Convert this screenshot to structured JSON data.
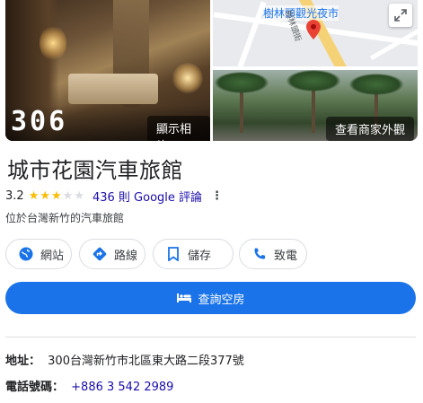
{
  "photos": {
    "main_overlay_number": "306",
    "show_photos_label": "顯示相片",
    "exterior_label": "查看商家外觀"
  },
  "map": {
    "poi_label": "樹林頭觀光夜市",
    "street_label": "樹林頭街"
  },
  "business": {
    "name": "城市花園汽車旅館",
    "rating": "3.2",
    "rating_value": 3.2,
    "rating_max": 5,
    "reviews_text": "436 則 Google 評論",
    "category": "位於台灣新竹的汽車旅館"
  },
  "actions": [
    {
      "label": "網站",
      "icon": "globe-icon"
    },
    {
      "label": "路線",
      "icon": "directions-icon"
    },
    {
      "label": "儲存",
      "icon": "bookmark-icon"
    },
    {
      "label": "致電",
      "icon": "phone-icon"
    }
  ],
  "primary": {
    "label": "查詢空房",
    "icon": "bed-icon"
  },
  "info": {
    "address_label": "地址：",
    "address_value": "300台灣新竹市北區東大路二段377號",
    "phone_label": "電話號碼：",
    "phone_value": "+886 3 542 2989"
  },
  "colors": {
    "accent": "#1a73e8",
    "star": "#fbbc04",
    "star_empty": "#dadce0",
    "link": "#1a0dab",
    "pin": "#ea4335"
  }
}
